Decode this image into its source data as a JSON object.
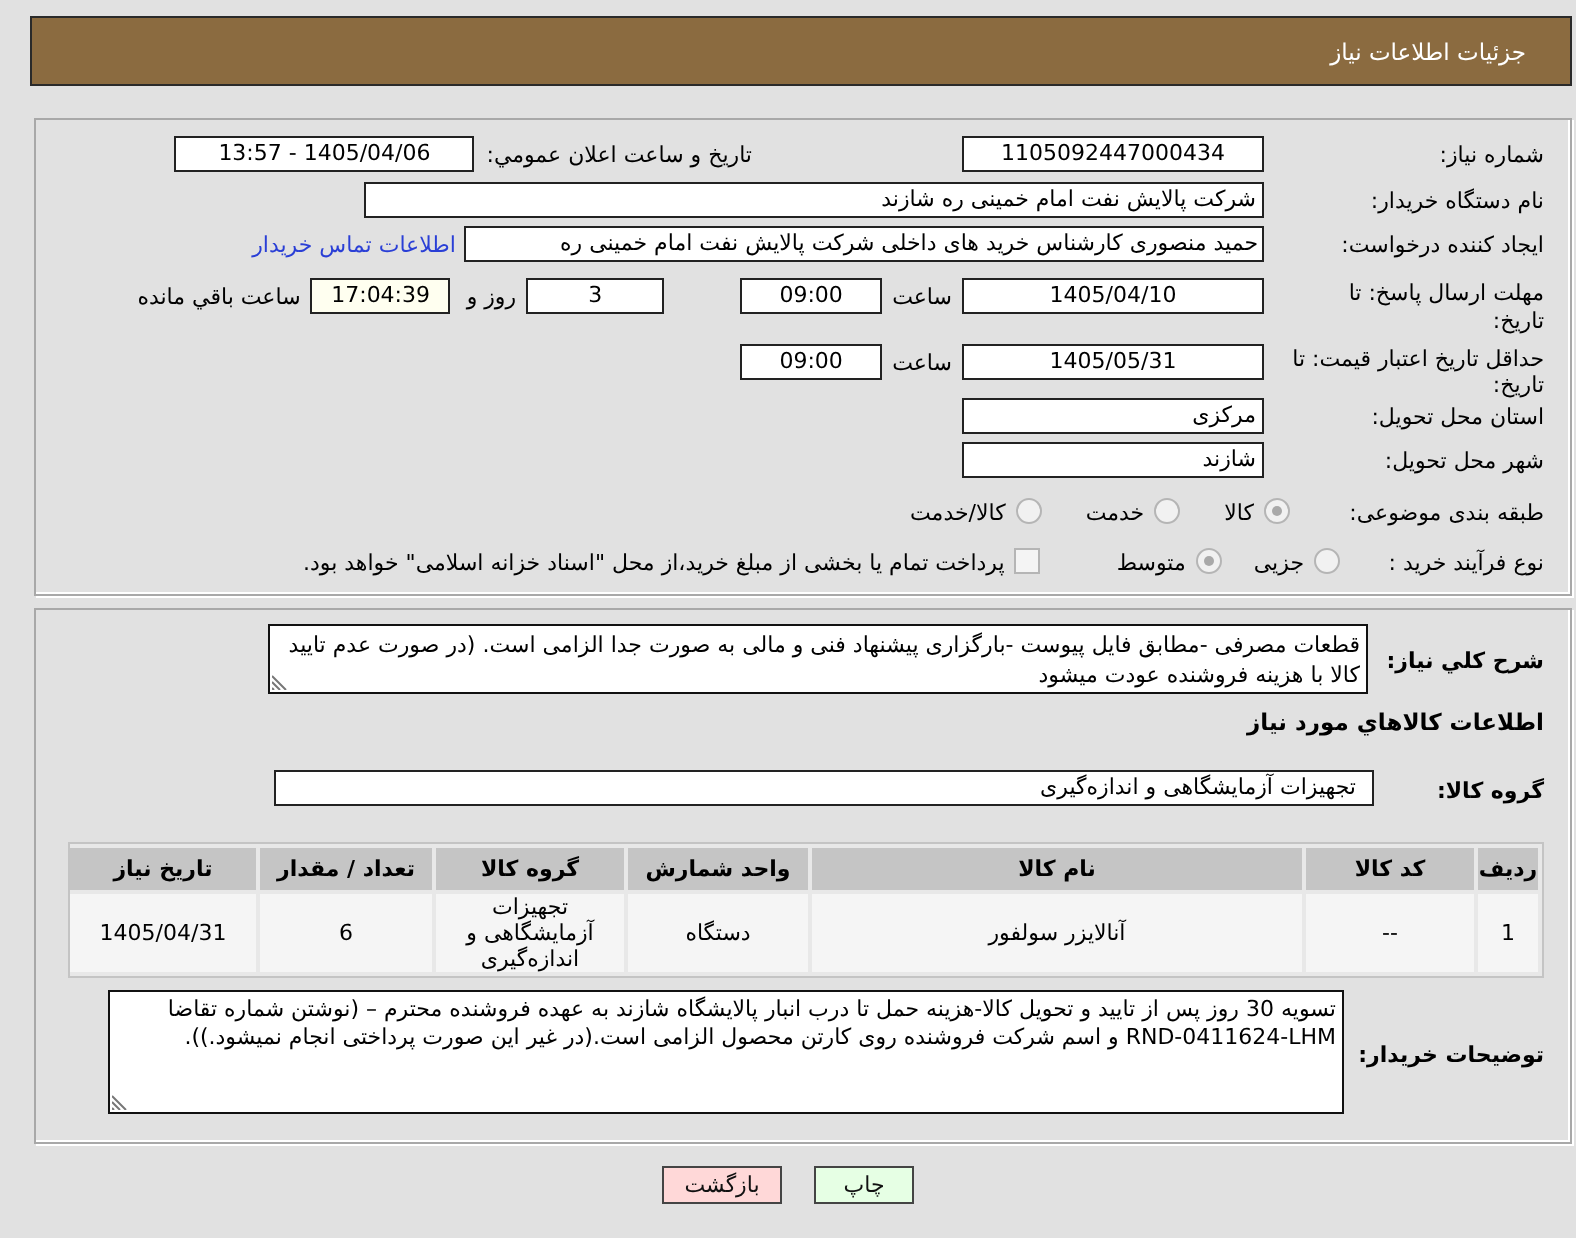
{
  "header": {
    "title": "جزئیات اطلاعات نیاز"
  },
  "details": {
    "need_number": {
      "label": "شماره نیاز:",
      "value": "1105092447000434"
    },
    "announce": {
      "label": "تاریخ و ساعت اعلان عمومي:",
      "value": "1405/04/06 - 13:57"
    },
    "buyer_org": {
      "label": "نام دستگاه خریدار:",
      "value": "شرکت پالایش نفت امام خمینی  ره  شازند"
    },
    "requester": {
      "label": "ایجاد کننده درخواست:",
      "value": "حمید منصوری کارشناس خرید های داخلی  شرکت پالایش نفت امام خمینی  ره",
      "contact_link": "اطلاعات تماس خریدار"
    },
    "response_deadline": {
      "label": "مهلت ارسال پاسخ: تا تاریخ:",
      "date": "1405/04/10",
      "time_label": "ساعت",
      "time": "09:00",
      "days": "3",
      "days_label": "روز و",
      "remaining": "17:04:39",
      "remaining_label": "ساعت باقي مانده"
    },
    "price_validity": {
      "label": "حداقل تاریخ اعتبار قیمت: تا تاریخ:",
      "date": "1405/05/31",
      "time_label": "ساعت",
      "time": "09:00"
    },
    "province": {
      "label": "استان محل تحویل:",
      "value": "مرکزی"
    },
    "city": {
      "label": "شهر محل تحویل:",
      "value": "شازند"
    },
    "category": {
      "label": "طبقه بندی موضوعی:",
      "options": [
        {
          "label": "کالا",
          "selected": true
        },
        {
          "label": "خدمت",
          "selected": false
        },
        {
          "label": "کالا/خدمت",
          "selected": false
        }
      ]
    },
    "process": {
      "label": "نوع فرآیند خرید :",
      "options": [
        {
          "label": "جزیی",
          "selected": false
        },
        {
          "label": "متوسط",
          "selected": true
        }
      ],
      "treasury": {
        "label": "پرداخت تمام یا بخشی از مبلغ خرید،از محل \"اسناد خزانه اسلامی\" خواهد بود.",
        "checked": false
      }
    }
  },
  "description": {
    "label": "شرح کلي نیاز:",
    "value": "قطعات مصرفی -مطابق فایل پیوست -بارگزاری پیشنهاد فنی و مالی به صورت جدا الزامی است. (در صورت عدم تایید کالا با هزینه فروشنده عودت میشود"
  },
  "goods": {
    "title": "اطلاعات کالاهاي مورد نیاز",
    "group_label": "گروه کالا:",
    "group_value": "تجهیزات آزمایشگاهی و اندازه‌گیری",
    "table": {
      "columns": [
        "ردیف",
        "کد کالا",
        "نام کالا",
        "واحد شمارش",
        "گروه کالا",
        "تعداد / مقدار",
        "تاریخ نیاز"
      ],
      "rows": [
        [
          "1",
          "--",
          "آنالایزر سولفور",
          "دستگاه",
          "تجهیزات آزمایشگاهی و اندازه‌گیری",
          "6",
          "1405/04/31"
        ]
      ]
    }
  },
  "buyer_notes": {
    "label": "توضیحات خریدار:",
    "value": "تسویه 30 روز پس از تایید و تحویل کالا-هزینه حمل تا درب انبار پالایشگاه شازند به عهده فروشنده محترم – (نوشتن شماره تقاضا RND-0411624-LHM و اسم شرکت فروشنده  روی کارتن محصول الزامی است.(در غیر این صورت پرداختی انجام نمیشود.))."
  },
  "buttons": [
    {
      "label": "چاپ",
      "kind": "print"
    },
    {
      "label": "بازگشت",
      "kind": "back"
    }
  ]
}
